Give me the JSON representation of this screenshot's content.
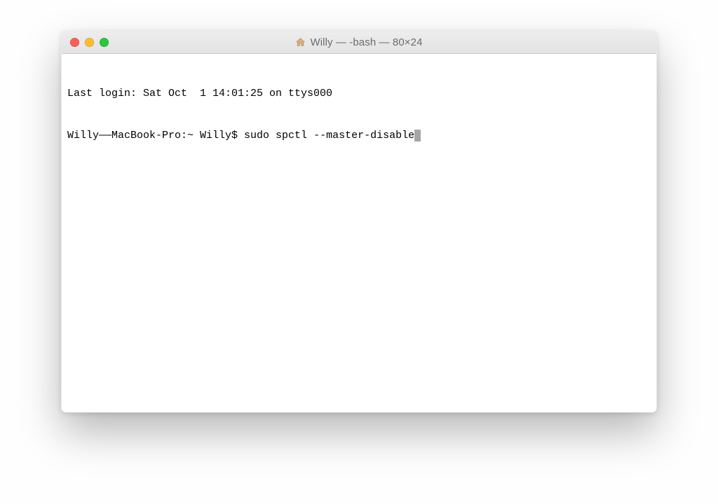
{
  "window": {
    "title": "Willy — -bash — 80×24"
  },
  "terminal": {
    "last_login_line": "Last login: Sat Oct  1 14:01:25 on ttys000",
    "prompt": "Willy——MacBook-Pro:~ Willy$ ",
    "command": "sudo spctl --master-disable"
  }
}
